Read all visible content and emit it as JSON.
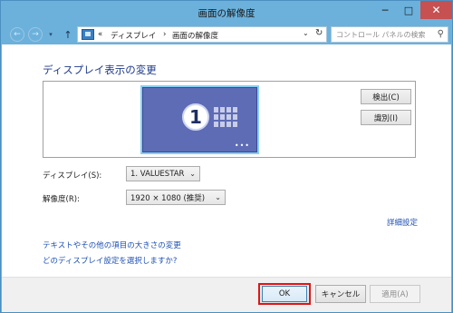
{
  "window": {
    "title": "画面の解像度",
    "controls": {
      "minimize": "─",
      "maximize": "□",
      "close": "✕"
    }
  },
  "nav": {
    "back": "←",
    "forward": "→",
    "history": "▾",
    "up": "↑",
    "breadcrumb": [
      "«",
      "ディスプレイ",
      "›",
      "画面の解像度"
    ],
    "address_dropdown": "⌄",
    "refresh": "↻",
    "search_placeholder": "コントロール パネルの検索",
    "search_icon": "⚲"
  },
  "main": {
    "heading": "ディスプレイ表示の変更",
    "monitor_number": "1",
    "monitor_dots": "•••",
    "detect_button": "検出(C)",
    "identify_button": "識別(I)",
    "display_label": "ディスプレイ(S):",
    "display_value": "1. VALUESTAR",
    "resolution_label": "解像度(R):",
    "resolution_value": "1920 × 1080 (推奨)",
    "advanced_link": "詳細設定",
    "link_text_size": "テキストやその他の項目の大きさの変更",
    "link_which_settings": "どのディスプレイ設定を選択しますか?"
  },
  "footer": {
    "ok": "OK",
    "cancel": "キャンセル",
    "apply": "適用(A)"
  },
  "colors": {
    "titlebar": "#6bb1dc",
    "heading": "#1e3a8a",
    "link": "#1e50b4",
    "monitor": "#5e6cb6",
    "highlight": "#e21414"
  }
}
